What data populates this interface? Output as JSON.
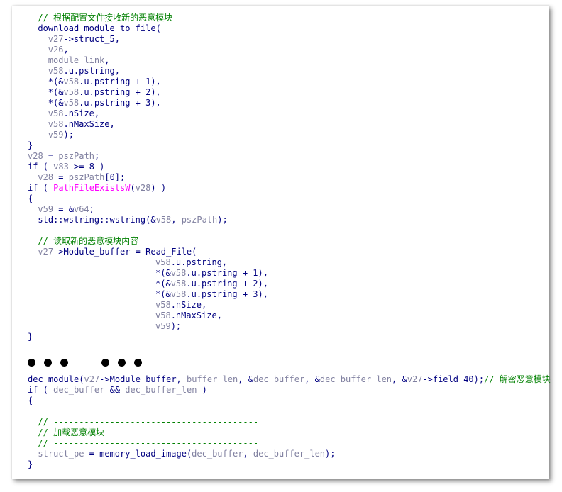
{
  "colors": {
    "comment": "#008000",
    "keyword": "#000080",
    "variable": "#8080a0",
    "import_function": "#ff00ff",
    "background": "#ffffff"
  },
  "code": {
    "lines": [
      {
        "indent": 1,
        "tokens": [
          {
            "c": "t-comment",
            "t": "// 根据配置文件接收新的恶意模块"
          }
        ]
      },
      {
        "indent": 1,
        "tokens": [
          {
            "c": "t-func",
            "t": "download_module_to_file"
          },
          {
            "c": "t-kw",
            "t": "("
          }
        ]
      },
      {
        "indent": 2,
        "tokens": [
          {
            "c": "t-var",
            "t": "v27"
          },
          {
            "c": "t-kw",
            "t": "->struct_5,"
          }
        ]
      },
      {
        "indent": 2,
        "tokens": [
          {
            "c": "t-var",
            "t": "v26"
          },
          {
            "c": "t-kw",
            "t": ","
          }
        ]
      },
      {
        "indent": 2,
        "tokens": [
          {
            "c": "t-var",
            "t": "module_link"
          },
          {
            "c": "t-kw",
            "t": ","
          }
        ]
      },
      {
        "indent": 2,
        "tokens": [
          {
            "c": "t-var",
            "t": "v58"
          },
          {
            "c": "t-kw",
            "t": ".u.pstring,"
          }
        ]
      },
      {
        "indent": 2,
        "tokens": [
          {
            "c": "t-kw",
            "t": "*(&"
          },
          {
            "c": "t-var",
            "t": "v58"
          },
          {
            "c": "t-kw",
            "t": ".u.pstring + 1),"
          }
        ]
      },
      {
        "indent": 2,
        "tokens": [
          {
            "c": "t-kw",
            "t": "*(&"
          },
          {
            "c": "t-var",
            "t": "v58"
          },
          {
            "c": "t-kw",
            "t": ".u.pstring + 2),"
          }
        ]
      },
      {
        "indent": 2,
        "tokens": [
          {
            "c": "t-kw",
            "t": "*(&"
          },
          {
            "c": "t-var",
            "t": "v58"
          },
          {
            "c": "t-kw",
            "t": ".u.pstring + 3),"
          }
        ]
      },
      {
        "indent": 2,
        "tokens": [
          {
            "c": "t-var",
            "t": "v58"
          },
          {
            "c": "t-kw",
            "t": ".nSize,"
          }
        ]
      },
      {
        "indent": 2,
        "tokens": [
          {
            "c": "t-var",
            "t": "v58"
          },
          {
            "c": "t-kw",
            "t": ".nMaxSize,"
          }
        ]
      },
      {
        "indent": 2,
        "tokens": [
          {
            "c": "t-var",
            "t": "v59"
          },
          {
            "c": "t-kw",
            "t": ");"
          }
        ]
      },
      {
        "indent": 0,
        "tokens": [
          {
            "c": "t-kw",
            "t": "}"
          }
        ]
      },
      {
        "indent": 0,
        "tokens": [
          {
            "c": "t-var",
            "t": "v28"
          },
          {
            "c": "t-kw",
            "t": " = "
          },
          {
            "c": "t-var",
            "t": "pszPath"
          },
          {
            "c": "t-kw",
            "t": ";"
          }
        ]
      },
      {
        "indent": 0,
        "tokens": [
          {
            "c": "t-kw",
            "t": "if ( "
          },
          {
            "c": "t-var",
            "t": "v83"
          },
          {
            "c": "t-kw",
            "t": " >= 8 )"
          }
        ]
      },
      {
        "indent": 1,
        "tokens": [
          {
            "c": "t-var",
            "t": "v28"
          },
          {
            "c": "t-kw",
            "t": " = "
          },
          {
            "c": "t-var",
            "t": "pszPath"
          },
          {
            "c": "t-kw",
            "t": "[0];"
          }
        ]
      },
      {
        "indent": 0,
        "tokens": [
          {
            "c": "t-kw",
            "t": "if ( "
          },
          {
            "c": "t-import",
            "t": "PathFileExistsW"
          },
          {
            "c": "t-kw",
            "t": "("
          },
          {
            "c": "t-var",
            "t": "v28"
          },
          {
            "c": "t-kw",
            "t": ") )"
          }
        ]
      },
      {
        "indent": 0,
        "tokens": [
          {
            "c": "t-kw",
            "t": "{"
          }
        ]
      },
      {
        "indent": 1,
        "tokens": [
          {
            "c": "t-var",
            "t": "v59"
          },
          {
            "c": "t-kw",
            "t": " = &"
          },
          {
            "c": "t-var",
            "t": "v64"
          },
          {
            "c": "t-kw",
            "t": ";"
          }
        ]
      },
      {
        "indent": 1,
        "tokens": [
          {
            "c": "t-kw",
            "t": "std::wstring::wstring(&"
          },
          {
            "c": "t-var",
            "t": "v58"
          },
          {
            "c": "t-kw",
            "t": ", "
          },
          {
            "c": "t-var",
            "t": "pszPath"
          },
          {
            "c": "t-kw",
            "t": ");"
          }
        ]
      },
      {
        "indent": 0,
        "tokens": []
      },
      {
        "indent": 1,
        "tokens": [
          {
            "c": "t-comment",
            "t": "// 读取新的恶意模块内容"
          }
        ]
      },
      {
        "indent": 1,
        "tokens": [
          {
            "c": "t-var",
            "t": "v27"
          },
          {
            "c": "t-kw",
            "t": "->Module_buffer = Read_File("
          }
        ]
      },
      {
        "indent": 12.5,
        "tokens": [
          {
            "c": "t-var",
            "t": "v58"
          },
          {
            "c": "t-kw",
            "t": ".u.pstring,"
          }
        ]
      },
      {
        "indent": 12.5,
        "tokens": [
          {
            "c": "t-kw",
            "t": "*(&"
          },
          {
            "c": "t-var",
            "t": "v58"
          },
          {
            "c": "t-kw",
            "t": ".u.pstring + 1),"
          }
        ]
      },
      {
        "indent": 12.5,
        "tokens": [
          {
            "c": "t-kw",
            "t": "*(&"
          },
          {
            "c": "t-var",
            "t": "v58"
          },
          {
            "c": "t-kw",
            "t": ".u.pstring + 2),"
          }
        ]
      },
      {
        "indent": 12.5,
        "tokens": [
          {
            "c": "t-kw",
            "t": "*(&"
          },
          {
            "c": "t-var",
            "t": "v58"
          },
          {
            "c": "t-kw",
            "t": ".u.pstring + 3),"
          }
        ]
      },
      {
        "indent": 12.5,
        "tokens": [
          {
            "c": "t-var",
            "t": "v58"
          },
          {
            "c": "t-kw",
            "t": ".nSize,"
          }
        ]
      },
      {
        "indent": 12.5,
        "tokens": [
          {
            "c": "t-var",
            "t": "v58"
          },
          {
            "c": "t-kw",
            "t": ".nMaxSize,"
          }
        ]
      },
      {
        "indent": 12.5,
        "tokens": [
          {
            "c": "t-var",
            "t": "v59"
          },
          {
            "c": "t-kw",
            "t": ");"
          }
        ]
      },
      {
        "indent": 0,
        "tokens": [
          {
            "c": "t-kw",
            "t": "}"
          }
        ]
      }
    ],
    "lines2": [
      {
        "indent": 0,
        "tokens": [
          {
            "c": "t-func",
            "t": "dec_module"
          },
          {
            "c": "t-kw",
            "t": "("
          },
          {
            "c": "t-var",
            "t": "v27"
          },
          {
            "c": "t-kw",
            "t": "->Module_buffer, "
          },
          {
            "c": "t-var",
            "t": "buffer_len"
          },
          {
            "c": "t-kw",
            "t": ", &"
          },
          {
            "c": "t-var",
            "t": "dec_buffer"
          },
          {
            "c": "t-kw",
            "t": ", &"
          },
          {
            "c": "t-var",
            "t": "dec_buffer_len"
          },
          {
            "c": "t-kw",
            "t": ", &"
          },
          {
            "c": "t-var",
            "t": "v27"
          },
          {
            "c": "t-kw",
            "t": "->field_40);"
          },
          {
            "c": "t-comment",
            "t": "// 解密恶意模块"
          }
        ]
      },
      {
        "indent": 0,
        "tokens": [
          {
            "c": "t-kw",
            "t": "if ( "
          },
          {
            "c": "t-var",
            "t": "dec_buffer"
          },
          {
            "c": "t-kw",
            "t": " && "
          },
          {
            "c": "t-var",
            "t": "dec_buffer_len"
          },
          {
            "c": "t-kw",
            "t": " )"
          }
        ]
      },
      {
        "indent": 0,
        "tokens": [
          {
            "c": "t-kw",
            "t": "{"
          }
        ]
      },
      {
        "indent": 0,
        "tokens": []
      },
      {
        "indent": 1,
        "tokens": [
          {
            "c": "t-comment",
            "t": "// ----------------------------------------"
          }
        ]
      },
      {
        "indent": 1,
        "tokens": [
          {
            "c": "t-comment",
            "t": "// 加载恶意模块"
          }
        ]
      },
      {
        "indent": 1,
        "tokens": [
          {
            "c": "t-comment",
            "t": "// ----------------------------------------"
          }
        ]
      },
      {
        "indent": 1,
        "tokens": [
          {
            "c": "t-var",
            "t": "struct_pe"
          },
          {
            "c": "t-kw",
            "t": " = "
          },
          {
            "c": "t-func",
            "t": "memory_load_image"
          },
          {
            "c": "t-kw",
            "t": "("
          },
          {
            "c": "t-var",
            "t": "dec_buffer"
          },
          {
            "c": "t-kw",
            "t": ", "
          },
          {
            "c": "t-var",
            "t": "dec_buffer_len"
          },
          {
            "c": "t-kw",
            "t": ");"
          }
        ]
      },
      {
        "indent": 0,
        "tokens": [
          {
            "c": "t-kw",
            "t": "}"
          }
        ]
      }
    ]
  }
}
